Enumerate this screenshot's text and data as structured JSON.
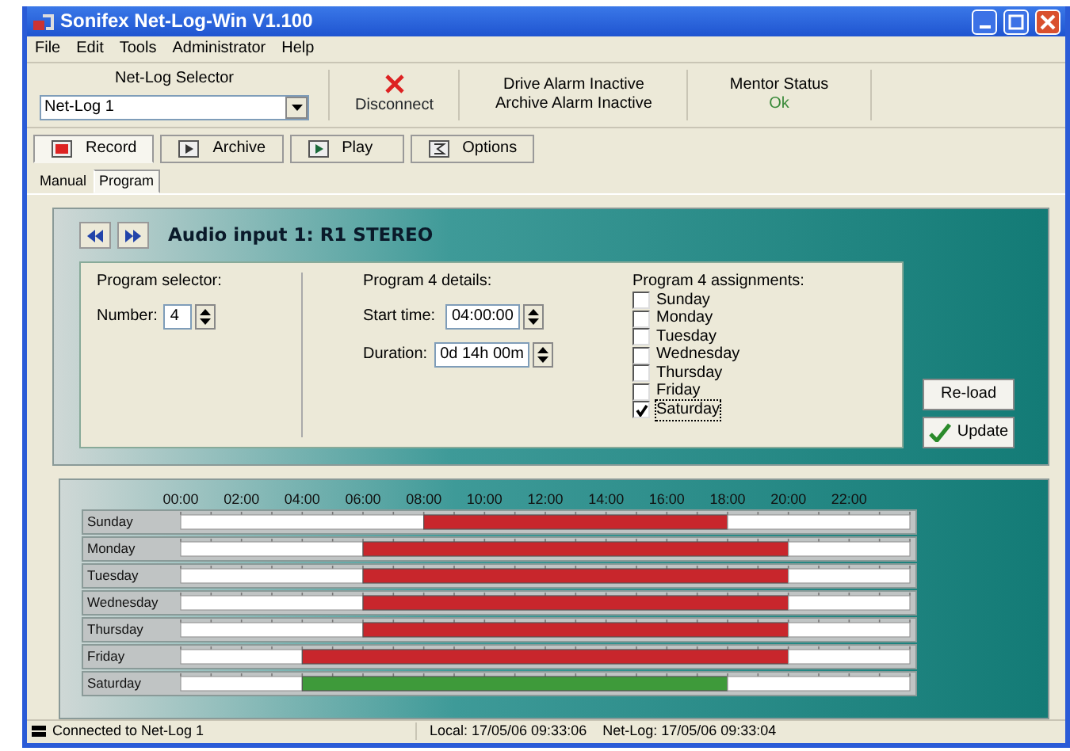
{
  "window": {
    "title": "Sonifex Net-Log-Win V1.100"
  },
  "menu": [
    "File",
    "Edit",
    "Tools",
    "Administrator",
    "Help"
  ],
  "toolbar": {
    "selector_label": "Net-Log Selector",
    "selector_value": "Net-Log 1",
    "disconnect": "Disconnect",
    "drive_alarm": "Drive Alarm Inactive",
    "archive_alarm": "Archive Alarm Inactive",
    "mentor_label": "Mentor Status",
    "mentor_value": "Ok"
  },
  "tabs": [
    {
      "label": "Record",
      "selected": true
    },
    {
      "label": "Archive",
      "selected": false
    },
    {
      "label": "Play",
      "selected": false
    },
    {
      "label": "Options",
      "selected": false
    }
  ],
  "subtabs": [
    {
      "label": "Manual",
      "selected": false
    },
    {
      "label": "Program",
      "selected": true
    }
  ],
  "panel": {
    "title": "Audio input 1:  R1 STEREO",
    "selector": {
      "heading": "Program selector:",
      "label": "Number:",
      "value": "4"
    },
    "details": {
      "heading": "Program 4 details:",
      "start_label": "Start time:",
      "start_value": "04:00:00",
      "duration_label": "Duration:",
      "duration_value": "0d 14h 00m"
    },
    "assignments": {
      "heading": "Program 4 assignments:",
      "days": [
        {
          "label": "Sunday",
          "checked": false
        },
        {
          "label": "Monday",
          "checked": false
        },
        {
          "label": "Tuesday",
          "checked": false
        },
        {
          "label": "Wednesday",
          "checked": false
        },
        {
          "label": "Thursday",
          "checked": false
        },
        {
          "label": "Friday",
          "checked": false
        },
        {
          "label": "Saturday",
          "checked": true
        }
      ]
    },
    "buttons": [
      "Re-load",
      "Update"
    ]
  },
  "schedule": {
    "chart_data": {
      "type": "bar",
      "orientation": "horizontal",
      "stacked": true,
      "categories": [
        "Sunday",
        "Monday",
        "Tuesday",
        "Wednesday",
        "Thursday",
        "Friday",
        "Saturday"
      ],
      "xlim": [
        0,
        24
      ],
      "xticks": [
        {
          "value": 0,
          "label": "00:00"
        },
        {
          "value": 2,
          "label": "02:00"
        },
        {
          "value": 4,
          "label": "04:00"
        },
        {
          "value": 6,
          "label": "06:00"
        },
        {
          "value": 8,
          "label": "08:00"
        },
        {
          "value": 10,
          "label": "10:00"
        },
        {
          "value": 12,
          "label": "12:00"
        },
        {
          "value": 14,
          "label": "14:00"
        },
        {
          "value": 16,
          "label": "16:00"
        },
        {
          "value": 18,
          "label": "18:00"
        },
        {
          "value": 20,
          "label": "20:00"
        },
        {
          "value": 22,
          "label": "22:00"
        }
      ],
      "series": [
        {
          "color": "#ffffff",
          "values": [
            8,
            6,
            6,
            6,
            6,
            4,
            4
          ]
        },
        {
          "color": "#c8262c",
          "values": [
            10,
            14,
            14,
            14,
            14,
            16,
            null
          ]
        },
        {
          "color": "#3e9a3a",
          "values": [
            null,
            null,
            null,
            null,
            null,
            null,
            14
          ]
        },
        {
          "color": "#ffffff",
          "values": [
            6,
            4,
            4,
            4,
            4,
            4,
            6
          ]
        }
      ]
    }
  },
  "status_bar": {
    "connection": "Connected to Net-Log 1",
    "clock": "Local: 17/05/06 09:33:06    Net-Log: 17/05/06 09:33:04"
  }
}
